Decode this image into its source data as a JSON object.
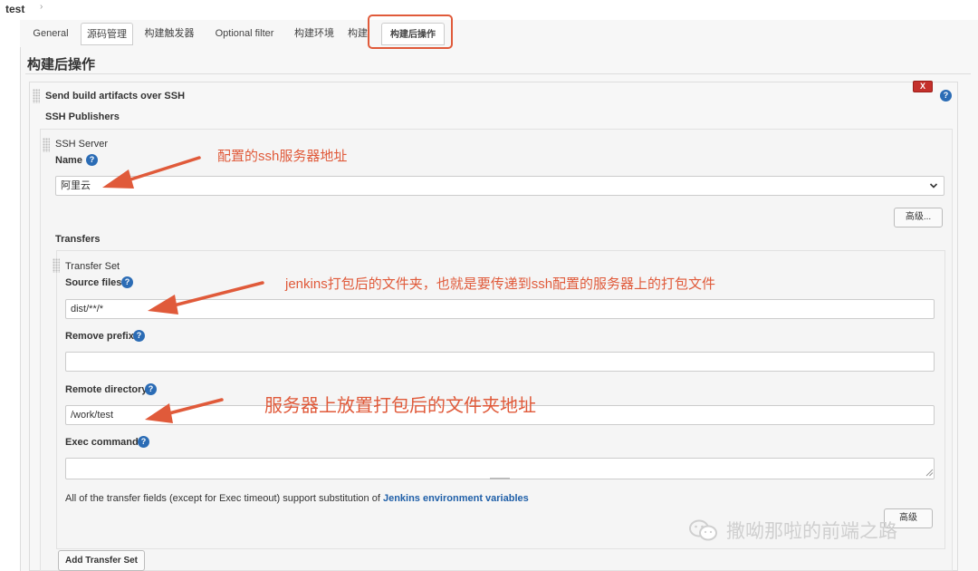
{
  "breadcrumb": {
    "job": "test",
    "separator": "›"
  },
  "tabs": [
    {
      "label": "General"
    },
    {
      "label": "源码管理"
    },
    {
      "label": "构建触发器"
    },
    {
      "label": "Optional filter"
    },
    {
      "label": "构建环境"
    },
    {
      "label": "构建"
    },
    {
      "label": "构建后操作"
    }
  ],
  "active_tab": "构建后操作",
  "section": {
    "title": "构建后操作"
  },
  "publisher": {
    "title": "Send build artifacts over SSH",
    "delete_label": "X",
    "ssh_publishers_label": "SSH Publishers",
    "ssh_server_label": "SSH Server",
    "name_label": "Name",
    "name_value": "阿里云",
    "advanced_label": "高级...",
    "transfers_label": "Transfers",
    "transfer_set_label": "Transfer Set",
    "source_files_label": "Source files",
    "source_files_value": "dist/**/*",
    "remove_prefix_label": "Remove prefix",
    "remove_prefix_value": "",
    "remote_directory_label": "Remote directory",
    "remote_directory_value": "/work/test",
    "exec_command_label": "Exec command",
    "exec_command_value": "",
    "note_text": "All of the transfer fields (except for Exec timeout) support substitution of ",
    "note_link": "Jenkins environment variables",
    "advanced2_label": "高级",
    "add_transfer_label": "Add Transfer Set",
    "help_glyph": "?"
  },
  "annotations": {
    "a1": "配置的ssh服务器地址",
    "a2": "jenkins打包后的文件夹，也就是要传递到ssh配置的服务器上的打包文件",
    "a3": "服务器上放置打包后的文件夹地址"
  },
  "watermark": "撒呦那啦的前端之路",
  "colors": {
    "annotation": "#e05a3a",
    "help": "#2b6cb5",
    "delete": "#c4302b",
    "link": "#1f5fa8"
  }
}
